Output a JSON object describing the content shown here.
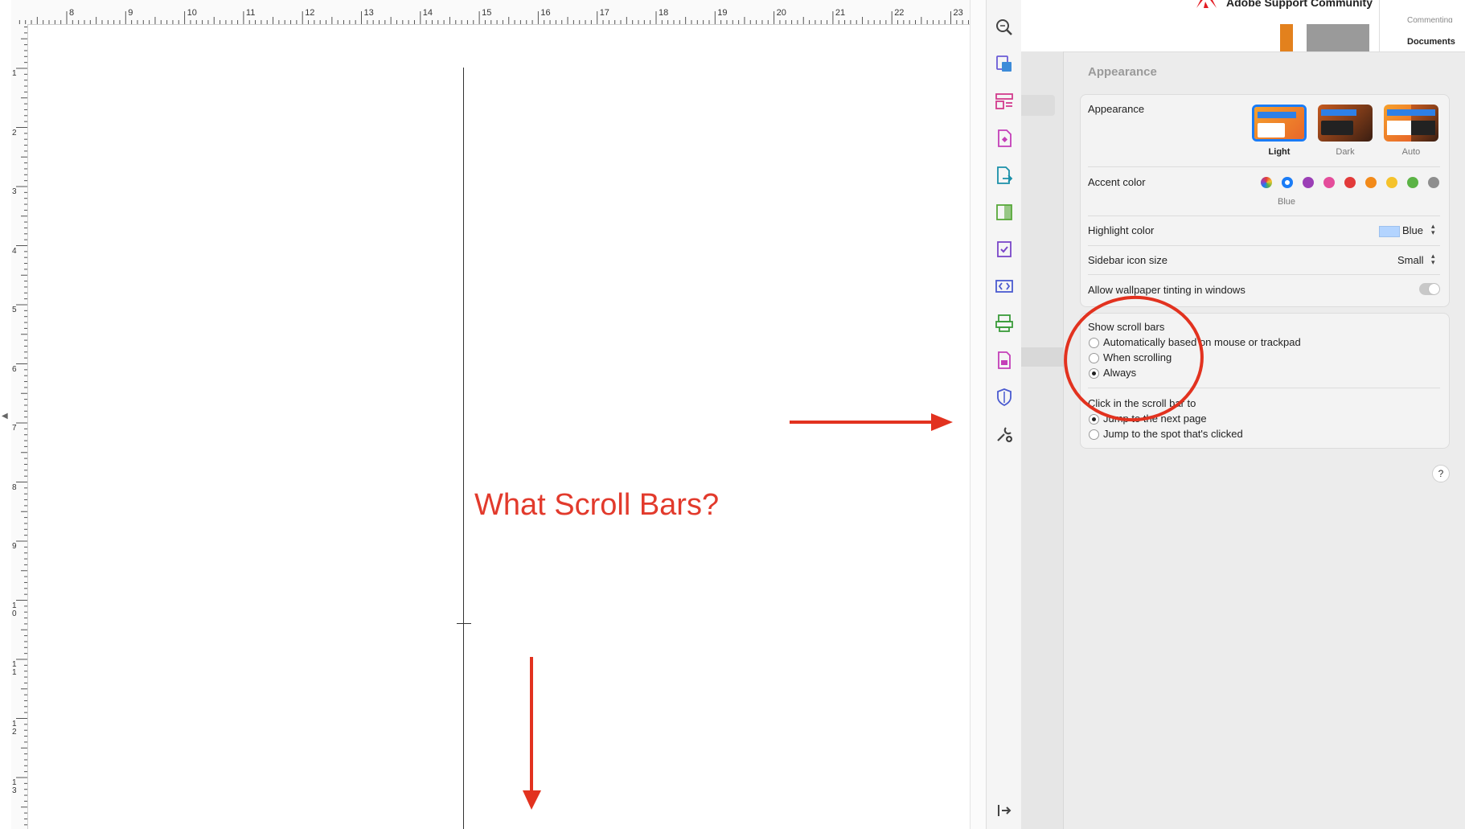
{
  "document": {
    "ruler_top_numbers": [
      "8",
      "9",
      "10",
      "11",
      "12",
      "13",
      "14",
      "15",
      "16",
      "17",
      "18",
      "19",
      "20",
      "21",
      "22",
      "23"
    ],
    "ruler_left_numbers": [
      "1",
      "2",
      "3",
      "4",
      "5",
      "6",
      "7",
      "8",
      "9",
      "1 0",
      "1 1",
      "1 2",
      "1 3"
    ],
    "annotation_text": "What Scroll Bars?",
    "annotation_color": "#e23a2c"
  },
  "tools_panel": {
    "icons": [
      "zoom-icon",
      "edit-pdf-icon",
      "organize-pages-icon",
      "create-pdf-icon",
      "export-pdf-icon",
      "compare-files-icon",
      "fill-sign-icon",
      "redact-icon",
      "scan-ocr-icon",
      "protect-icon",
      "shield-icon",
      "more-tools-icon"
    ],
    "bottom_icon": "collapse-panel-icon"
  },
  "forum_header": {
    "brand": "Adobe Support Community",
    "brand_color": "#e31b23",
    "nav_item": "Documents",
    "nav_item_partial": "Commenting"
  },
  "settings": {
    "section_title": "Appearance",
    "appearance": {
      "label": "Appearance",
      "options": [
        "Light",
        "Dark",
        "Auto"
      ],
      "selected": "Light"
    },
    "accent_color": {
      "label": "Accent color",
      "selected_name": "Blue",
      "colors": [
        "multicolor",
        "#1a7cf6",
        "#9b3fb6",
        "#e44d9b",
        "#e23a3a",
        "#f28a1a",
        "#f5c22b",
        "#5bb345",
        "#8e8e8e"
      ]
    },
    "highlight_color": {
      "label": "Highlight color",
      "value": "Blue",
      "swatch": "#b3d4ff"
    },
    "sidebar_icon_size": {
      "label": "Sidebar icon size",
      "value": "Small"
    },
    "wallpaper_tinting": {
      "label": "Allow wallpaper tinting in windows",
      "enabled": false
    },
    "show_scroll_bars": {
      "label": "Show scroll bars",
      "options": [
        "Automatically based on mouse or trackpad",
        "When scrolling",
        "Always"
      ],
      "selected": "Always"
    },
    "click_scroll_bar": {
      "label": "Click in the scroll bar to",
      "options": [
        "Jump to the next page",
        "Jump to the spot that's clicked"
      ],
      "selected": "Jump to the next page"
    },
    "help_label": "?"
  }
}
